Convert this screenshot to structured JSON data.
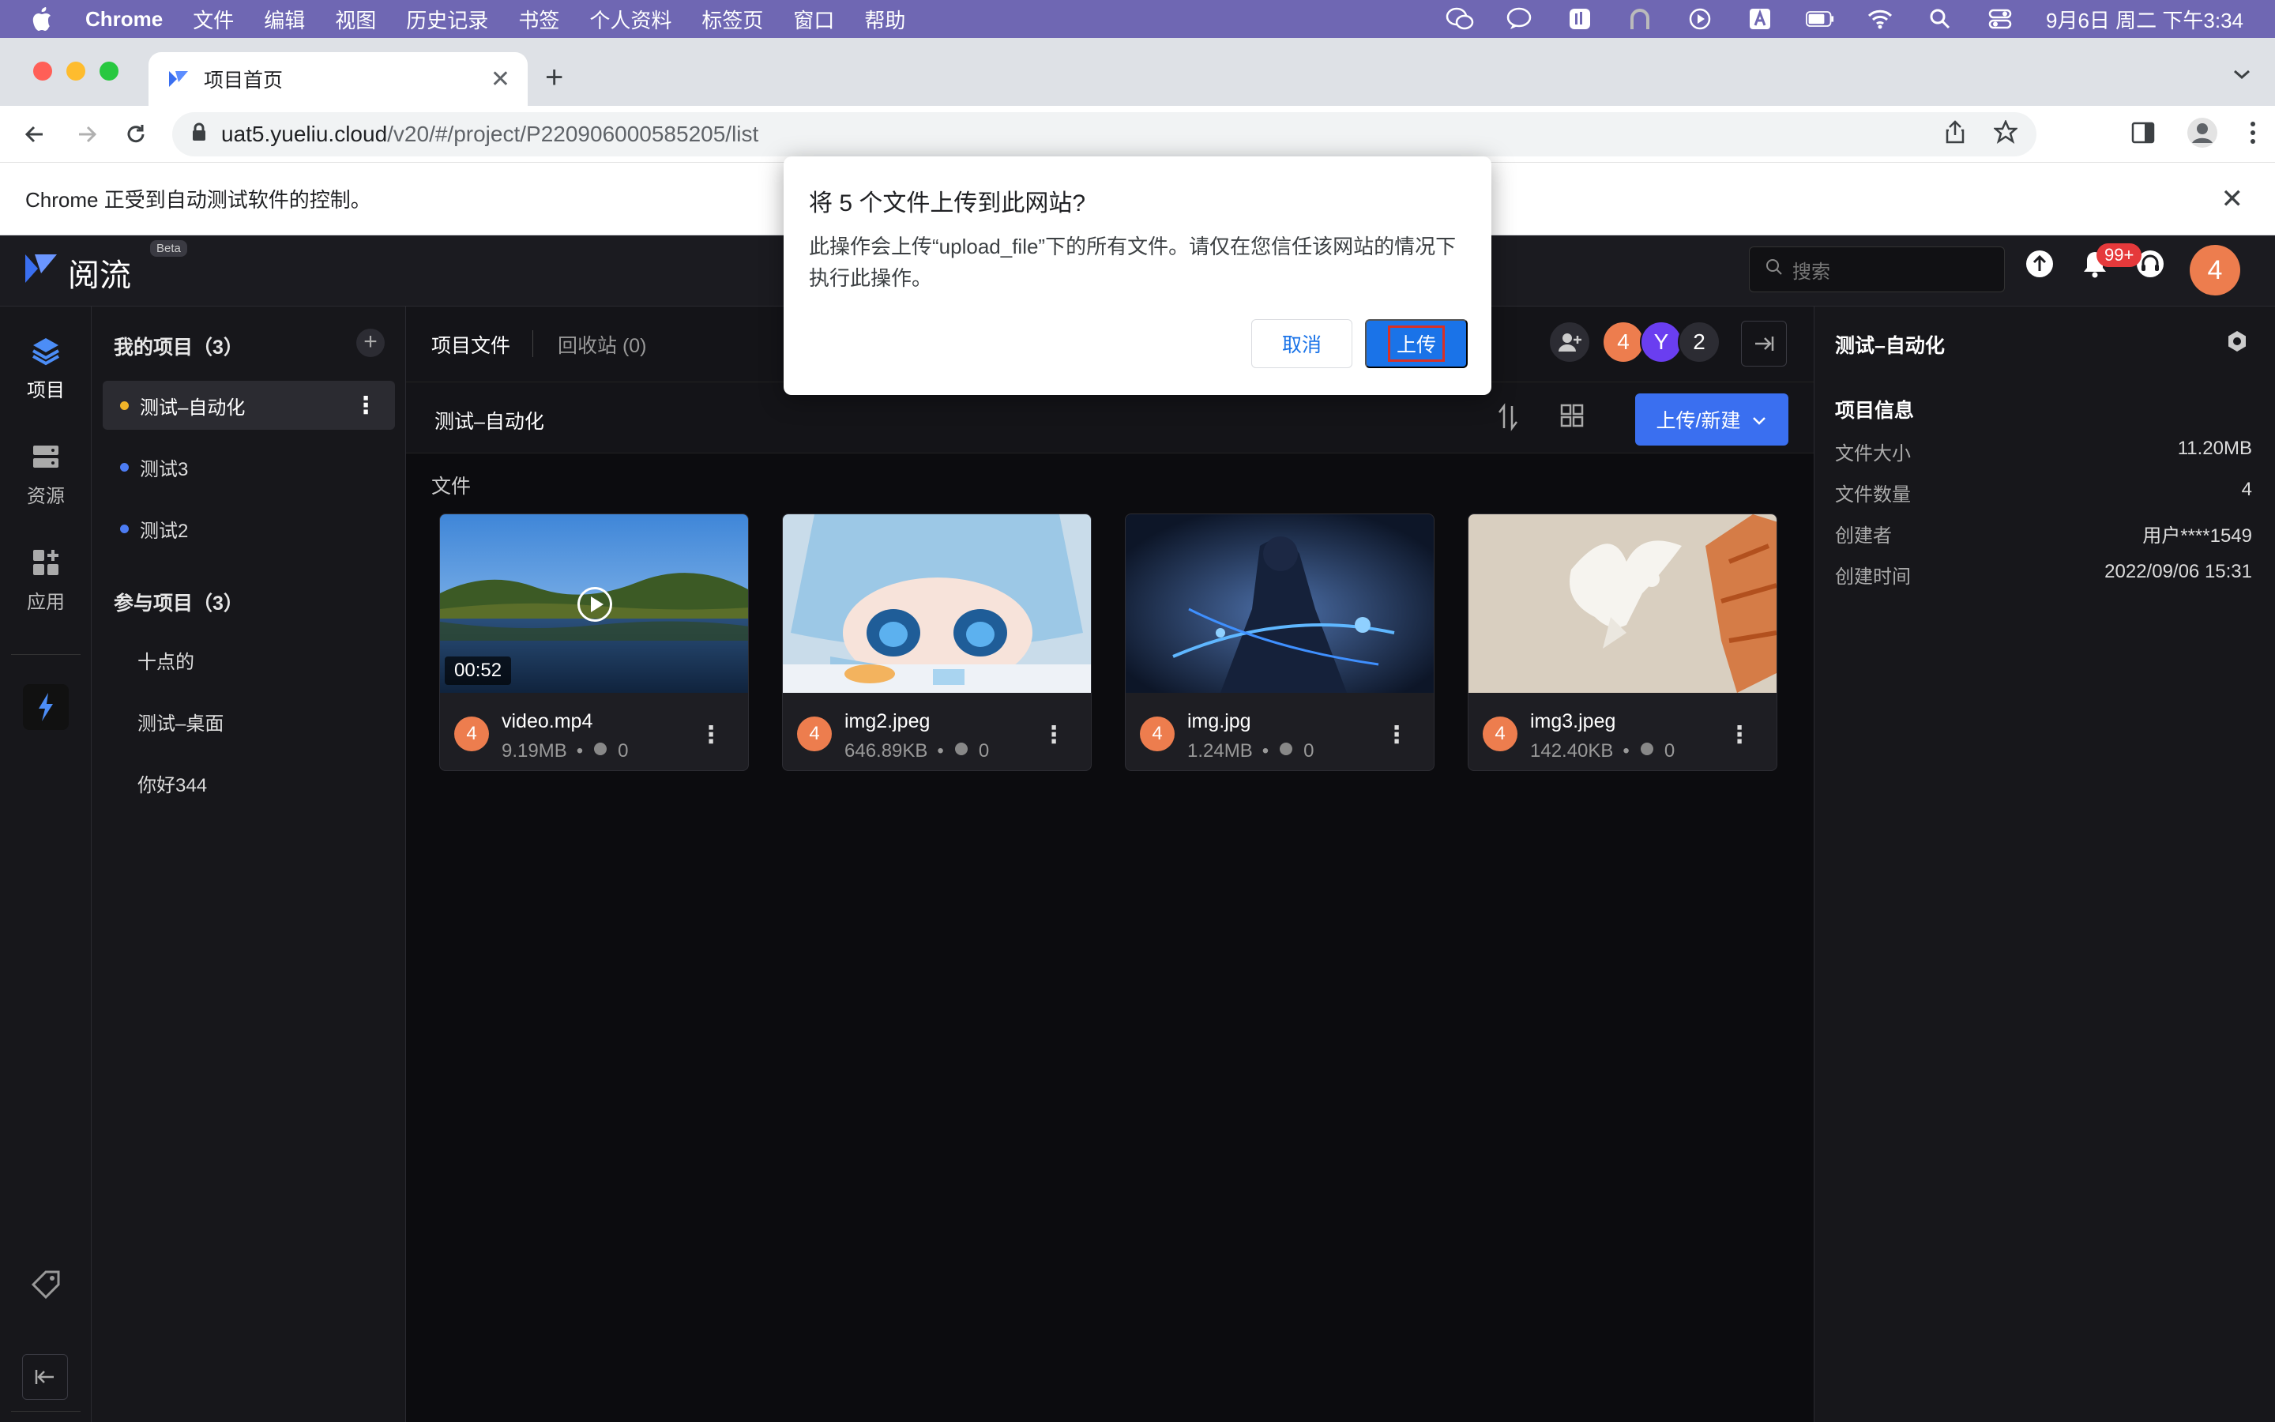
{
  "menubar": {
    "app": "Chrome",
    "items": [
      "文件",
      "编辑",
      "视图",
      "历史记录",
      "书签",
      "个人资料",
      "标签页",
      "窗口",
      "帮助"
    ],
    "clock": "9月6日 周二 下午3:34"
  },
  "browser": {
    "tab_title": "项目首页",
    "url_host": "uat5.yueliu.cloud",
    "url_path": "/v20/#/project/P220906000585205/list",
    "infobar_text": "Chrome 正受到自动测试软件的控制。"
  },
  "dialog": {
    "title": "将 5 个文件上传到此网站?",
    "message": "此操作会上传“upload_file”下的所有文件。请仅在您信任该网站的情况下执行此操作。",
    "cancel_label": "取消",
    "ok_label": "上传"
  },
  "app": {
    "logo_text": "阅流",
    "beta": "Beta",
    "search_placeholder": "搜索",
    "notification_badge": "99+",
    "user_avatar": "4",
    "rail": [
      {
        "label": "项目",
        "icon": "layers-icon"
      },
      {
        "label": "资源",
        "icon": "storage-icon"
      },
      {
        "label": "应用",
        "icon": "apps-icon"
      }
    ],
    "my_projects_title": "我的项目（3）",
    "my_projects": [
      {
        "name": "测试–自动化",
        "color": "#f0b429"
      },
      {
        "name": "测试3",
        "color": "#4c7cf3"
      },
      {
        "name": "测试2",
        "color": "#4c7cf3"
      }
    ],
    "joined_projects_title": "参与项目（3）",
    "joined_projects": [
      "十点的",
      "测试–桌面",
      "你好344"
    ],
    "tabs": {
      "files": "项目文件",
      "trash": "回收站 (0)"
    },
    "members": [
      "4",
      "Y",
      "2"
    ],
    "folder_title": "测试–自动化",
    "upload_button": "上传/新建",
    "files_label": "文件",
    "files": [
      {
        "name": "video.mp4",
        "size": "9.19MB",
        "comments": "0",
        "duration": "00:52",
        "owner": "4"
      },
      {
        "name": "img2.jpeg",
        "size": "646.89KB",
        "comments": "0",
        "owner": "4"
      },
      {
        "name": "img.jpg",
        "size": "1.24MB",
        "comments": "0",
        "owner": "4"
      },
      {
        "name": "img3.jpeg",
        "size": "142.40KB",
        "comments": "0",
        "owner": "4"
      }
    ],
    "right_panel": {
      "title": "测试–自动化",
      "section": "项目信息",
      "rows": [
        {
          "k": "文件大小",
          "v": "11.20MB"
        },
        {
          "k": "文件数量",
          "v": "4"
        },
        {
          "k": "创建者",
          "v": "用户****1549"
        },
        {
          "k": "创建时间",
          "v": "2022/09/06 15:31"
        }
      ]
    }
  }
}
